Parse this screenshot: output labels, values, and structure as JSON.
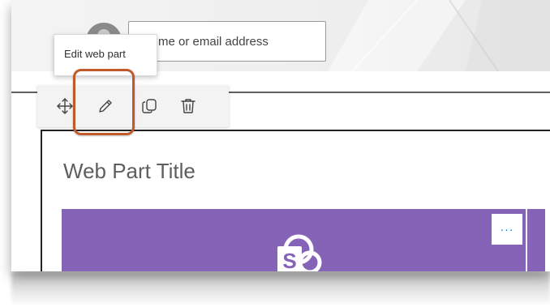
{
  "header": {
    "search": {
      "placeholder": "me or email address"
    }
  },
  "tooltip": {
    "text": "Edit web part"
  },
  "toolbar": {
    "buttons": [
      {
        "icon": "move-icon",
        "label": "Move web part"
      },
      {
        "icon": "pencil-icon",
        "label": "Edit web part"
      },
      {
        "icon": "duplicate-icon",
        "label": "Duplicate web part"
      },
      {
        "icon": "trash-icon",
        "label": "Delete web part"
      }
    ]
  },
  "webpart": {
    "title": "Web Part Title",
    "more_label": "···",
    "tile_color": "#8564b8",
    "logo_icon": "sharepoint-logo-icon"
  },
  "colors": {
    "highlight": "#c05a2b",
    "accent": "#0078d4"
  }
}
